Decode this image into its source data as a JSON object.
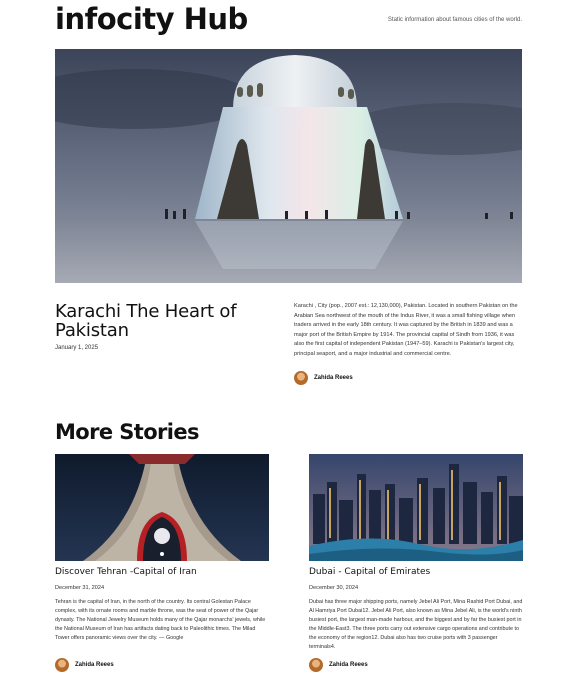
{
  "site": {
    "title": "infocity Hub",
    "tagline": "Static information about famous cities of the world."
  },
  "featured": {
    "image_alt": "Mazar-e-Quaid mausoleum at dusk",
    "title": "Karachi The Heart of Pakistan",
    "date": "January 1, 2025",
    "excerpt": "Karachi , City (pop., 2007 est.: 12,130,000), Pakistan. Located in southern Pakistan on the Arabian Sea northwest of the mouth of the Indus River, it was a small fishing village when traders arrived in the early 18th century. It was captured by the British in 1839 and was a major port of the British Empire by 1914. The provincial capital of Sindh from 1936, it was also the first capital of independent Pakistan (1947–59). Karachi is Pakistan's largest city, principal seaport, and a major industrial and commercial centre.",
    "author": "Zahida Reees"
  },
  "more_stories": {
    "heading": "More Stories",
    "items": [
      {
        "image_alt": "Azadi Tower in Tehran at night",
        "title": "Discover Tehran -Capital of Iran",
        "date": "December 31, 2024",
        "excerpt": "Tehran is the capital of Iran, in the north of the country. Its central Golestan Palace complex, with its ornate rooms and marble throne, was the seat of power of the Qajar dynasty. The National Jewelry Museum holds many of the Qajar monarchs' jewels, while the National Museum of Iran has artifacts dating back to Paleolithic times. The Milad Tower offers panoramic views over the city. — Google",
        "author": "Zahida Reees"
      },
      {
        "image_alt": "Dubai marina skyline at dusk",
        "title": "Dubai - Capital of Emirates",
        "date": "December 30, 2024",
        "excerpt": "Dubai has three major shipping ports, namely Jebel Ali Port, Mina Rashid Port Dubai, and Al Hamriya Port Dubai12. Jebel Ali Port, also known as Mina Jebel Ali, is the world's ninth busiest port, the largest man-made harbour, and the biggest and by far the busiest port in the Middle-East3. The three ports carry out extensive cargo operations and contribute to the economy of the region12. Dubai also has two cruise ports with 3 passenger terminals4.",
        "author": "Zahida Reees"
      }
    ]
  }
}
